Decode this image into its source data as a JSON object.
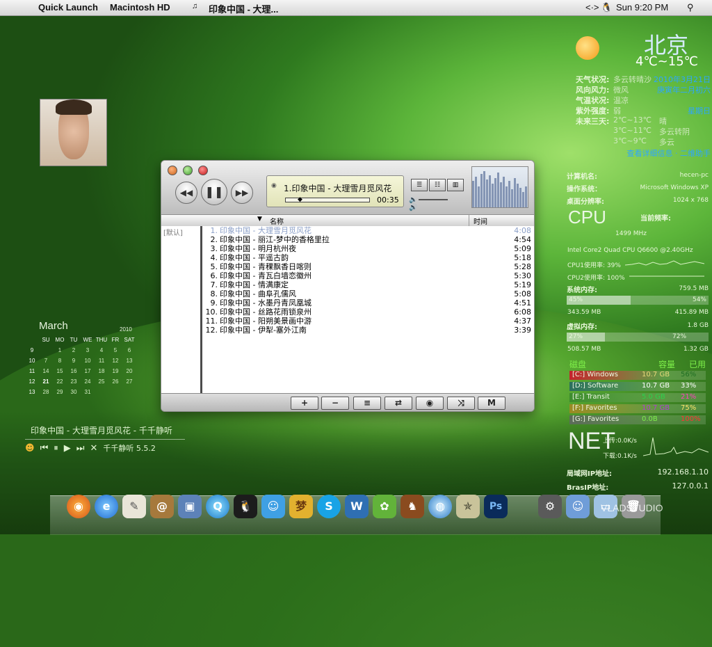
{
  "menubar": {
    "apple": "",
    "items": [
      "Quick Launch",
      "Macintosh HD",
      "印象中国 - 大理..."
    ],
    "time": "Sun 9:20 PM",
    "arrows": "<·>"
  },
  "calendar": {
    "month": "March",
    "year": "2010",
    "days_header": [
      "SU",
      "MO",
      "TU",
      "WE",
      "THU",
      "FR",
      "SAT"
    ],
    "weeks": [
      {
        "wk": "9",
        "d": [
          "",
          "1",
          "2",
          "3",
          "4",
          "5",
          "6"
        ]
      },
      {
        "wk": "10",
        "d": [
          "7",
          "8",
          "9",
          "10",
          "11",
          "12",
          "13"
        ]
      },
      {
        "wk": "11",
        "d": [
          "14",
          "15",
          "16",
          "17",
          "18",
          "19",
          "20"
        ]
      },
      {
        "wk": "12",
        "d": [
          "21",
          "22",
          "23",
          "24",
          "25",
          "26",
          "27"
        ]
      },
      {
        "wk": "13",
        "d": [
          "28",
          "29",
          "30",
          "31",
          "",
          "",
          ""
        ]
      }
    ]
  },
  "miniplayer": {
    "title": "印象中国 - 大理雪月觅风花 - 千千静听",
    "app": "千千静听 5.5.2"
  },
  "player": {
    "now_playing": "1.印象中国 - 大理雪月觅风花",
    "elapsed": "00:35",
    "col_name": "名称",
    "col_time": "时间",
    "list_label": "[默认]",
    "tracks": [
      {
        "n": "1.",
        "title": "印象中国 - 大理雪月觅风花",
        "time": "4:08"
      },
      {
        "n": "2.",
        "title": "印象中国 - 丽江-梦中的香格里拉",
        "time": "4:54"
      },
      {
        "n": "3.",
        "title": "印象中国 - 明月杭州夜",
        "time": "5:09"
      },
      {
        "n": "4.",
        "title": "印象中国 - 平遥古韵",
        "time": "5:18"
      },
      {
        "n": "5.",
        "title": "印象中国 - 青稞飘香日喀则",
        "time": "5:28"
      },
      {
        "n": "6.",
        "title": "印象中国 - 青瓦白墙恋徽州",
        "time": "5:30"
      },
      {
        "n": "7.",
        "title": "印象中国 - 情满康定",
        "time": "5:19"
      },
      {
        "n": "8.",
        "title": "印象中国 - 曲阜孔儒风",
        "time": "5:08"
      },
      {
        "n": "9.",
        "title": "印象中国 - 水墨丹青凤凰城",
        "time": "4:51"
      },
      {
        "n": "10.",
        "title": "印象中国 - 丝路花雨锁泉州",
        "time": "6:08"
      },
      {
        "n": "11.",
        "title": "印象中国 - 阳朔美景画中游",
        "time": "4:37"
      },
      {
        "n": "12.",
        "title": "印象中国 - 伊犁-塞外江南",
        "time": "3:39"
      }
    ],
    "buttons": [
      "+",
      "−",
      "≡",
      "⇄",
      "◉",
      "⤨",
      "M"
    ]
  },
  "weather": {
    "city": "北京",
    "temp": "4℃~15℃",
    "rows": [
      {
        "k": "天气状况:",
        "v": "多云转晴沙",
        "r": "2010年3月21日"
      },
      {
        "k": "风向风力:",
        "v": "微风",
        "r": "庚寅年二月初六"
      },
      {
        "k": "气温状况:",
        "v": "温凉",
        "r": ""
      },
      {
        "k": "紫外强度:",
        "v": "弱",
        "r": "星期日"
      }
    ],
    "forecast_label": "未来三天:",
    "forecast": [
      {
        "t": "2℃~13℃",
        "w": "晴"
      },
      {
        "t": "3℃~11℃",
        "w": "多云转阴"
      },
      {
        "t": "3℃~9℃",
        "w": "多云"
      }
    ],
    "link": "查看详细信息 · 二维助手"
  },
  "sys": {
    "computer_label": "计算机名:",
    "computer": "hecen-pc",
    "os_label": "操作系统：",
    "os": "Microsoft Windows XP",
    "res_label": "桌面分辨率:",
    "res": "1024 x 768",
    "cpu_word": "CPU",
    "freq_label": "当前频率:",
    "freq": "1499 MHz",
    "cpu_model": "Intel Core2 Quad CPU Q6600 @2.40GHz",
    "cpu1": "CPU1使用率: 39%",
    "cpu2": "CPU2使用率: 100%",
    "mem_label": "系统内存:",
    "mem_total": "759.5 MB",
    "mem_used_pct": "45%",
    "mem_free_pct": "54%",
    "mem_used": "343.59 MB",
    "mem_free": "415.89 MB",
    "vmem_label": "虚拟内存:",
    "vmem_total": "1.8 GB",
    "vmem_used_pct": "27%",
    "vmem_free_pct": "72%",
    "vmem_used": "508.57 MB",
    "vmem_free": "1.32 GB",
    "disk_header": [
      "磁盘",
      "容量",
      "已用"
    ],
    "disks": [
      {
        "name": "[C:] Windows",
        "cap": "10.7 GB",
        "used": "56%"
      },
      {
        "name": "[D:] Software",
        "cap": "10.7 GB",
        "used": "33%"
      },
      {
        "name": "[E:] Transit",
        "cap": "5.0 GB",
        "used": "21%"
      },
      {
        "name": "[F:] Favorites",
        "cap": "10.7 GB",
        "used": "75%"
      },
      {
        "name": "[G:] Favorites",
        "cap": "0.0B",
        "used": "100%"
      }
    ],
    "net_word": "NET",
    "up": "上传:0.0K/s",
    "down": "下载:0.1K/s",
    "lan_label": "局域网IP地址:",
    "lan": "192.168.1.10",
    "bras_label": "BrasIP地址:",
    "bras": "127.0.0.1"
  },
  "watermark": "VLADSTUDIO",
  "colors": {
    "accent_blue": "#2da6ff",
    "now_playing": "#8ca0c8"
  }
}
